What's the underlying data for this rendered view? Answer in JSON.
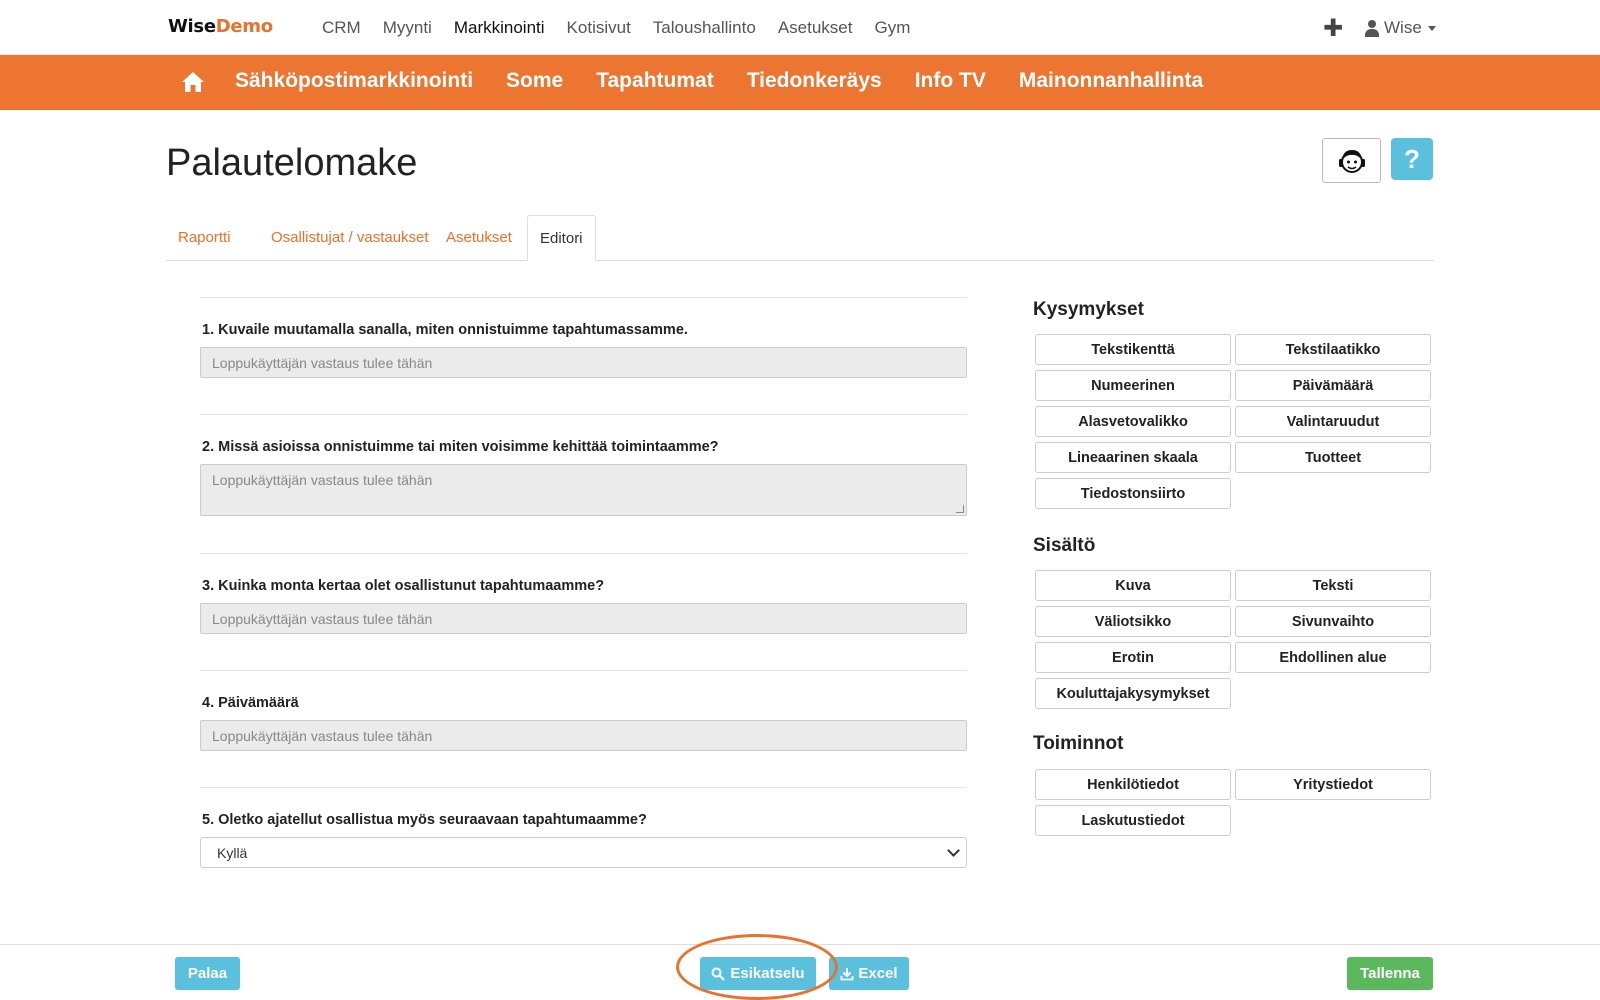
{
  "topnav": {
    "logo_part1": "Wise",
    "logo_part2": "Demo",
    "items": [
      "CRM",
      "Myynti",
      "Markkinointi",
      "Kotisivut",
      "Taloushallinto",
      "Asetukset",
      "Gym"
    ],
    "active": "Markkinointi",
    "user": "Wise"
  },
  "subnav": {
    "items": [
      "Sähköpostimarkkinointi",
      "Some",
      "Tapahtumat",
      "Tiedonkeräys",
      "Info TV",
      "Mainonnanhallinta"
    ]
  },
  "page": {
    "title": "Palautelomake",
    "help_label": "?"
  },
  "tabs": [
    {
      "label": "Raportti"
    },
    {
      "label": "Osallistujat / vastaukset"
    },
    {
      "label": "Asetukset"
    },
    {
      "label": "Editori",
      "active": true
    }
  ],
  "form": {
    "placeholder": "Loppukäyttäjän vastaus tulee tähän",
    "questions": [
      {
        "label": "1. Kuvaile muutamalla sanalla, miten onnistuimme tapahtumassamme.",
        "type": "text"
      },
      {
        "label": "2. Missä asioissa onnistuimme tai miten voisimme kehittää toimintaamme?",
        "type": "textarea"
      },
      {
        "label": "3. Kuinka monta kertaa olet osallistunut tapahtumaamme?",
        "type": "text"
      },
      {
        "label": "4. Päivämäärä",
        "type": "text"
      },
      {
        "label": "5. Oletko ajatellut osallistua myös seuraavaan tapahtumaamme?",
        "type": "select",
        "value": "Kyllä"
      }
    ]
  },
  "panel": {
    "kysymykset": {
      "title": "Kysymykset",
      "buttons": [
        "Tekstikenttä",
        "Tekstilaatikko",
        "Numeerinen",
        "Päivämäärä",
        "Alasvetovalikko",
        "Valintaruudut",
        "Lineaarinen skaala",
        "Tuotteet",
        "Tiedostonsiirto"
      ]
    },
    "sisalto": {
      "title": "Sisältö",
      "buttons": [
        "Kuva",
        "Teksti",
        "Väliotsikko",
        "Sivunvaihto",
        "Erotin",
        "Ehdollinen alue",
        "Kouluttajakysymykset"
      ]
    },
    "toiminnot": {
      "title": "Toiminnot",
      "buttons": [
        "Henkilötiedot",
        "Yritystiedot",
        "Laskutustiedot"
      ]
    }
  },
  "footer": {
    "back": "Palaa",
    "preview": "Esikatselu",
    "excel": "Excel",
    "save": "Tallenna"
  },
  "colors": {
    "brand_orange": "#ec7631",
    "info_blue": "#5bc0de",
    "success_green": "#5cb85c"
  },
  "icons": [
    "home-icon",
    "plus-icon",
    "user-icon",
    "support-agent-icon",
    "search-icon",
    "download-icon"
  ]
}
